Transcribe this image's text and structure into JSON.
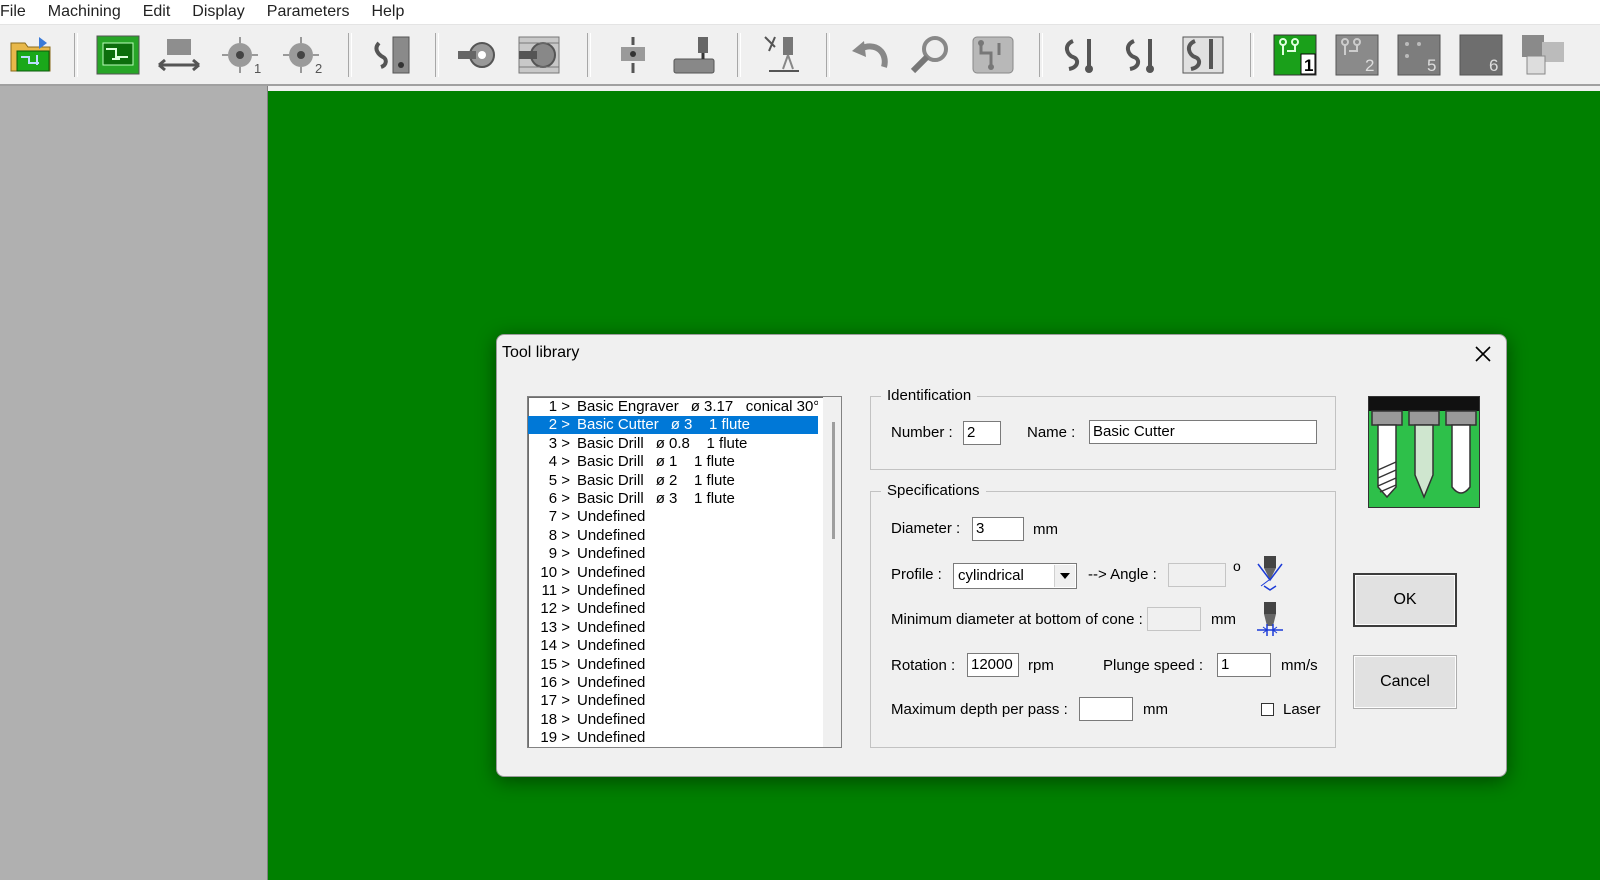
{
  "menu": [
    "File",
    "Machining",
    "Edit",
    "Display",
    "Parameters",
    "Help"
  ],
  "colors": {
    "canvas": "#008000",
    "selection": "#0078d7",
    "panel": "#b0b0b0"
  },
  "toolbar": {
    "icons": [
      "open-board-icon",
      "pcb-board-icon",
      "align-icon",
      "drill-side-1-icon",
      "drill-side-2-icon",
      "routing-icon",
      "pad-icon",
      "multipad-icon",
      "probe-icon",
      "cnc-spindle-icon",
      "laser-icon",
      "undo-icon",
      "zoom-icon",
      "circuit-icon",
      "track-1-icon",
      "track-2-icon",
      "track-3-icon"
    ],
    "layer_buttons": [
      "1",
      "2",
      "5",
      "6"
    ]
  },
  "dialog": {
    "title": "Tool library",
    "tools": [
      {
        "num": "1 >",
        "name": "Basic Engraver",
        "spec": "ø 3.17   conical 30°"
      },
      {
        "num": "2 >",
        "name": "Basic Cutter",
        "spec": "ø 3    1 flute"
      },
      {
        "num": "3 >",
        "name": "Basic Drill",
        "spec": "ø 0.8    1 flute"
      },
      {
        "num": "4 >",
        "name": "Basic Drill",
        "spec": "ø 1    1 flute"
      },
      {
        "num": "5 >",
        "name": "Basic Drill",
        "spec": "ø 2    1 flute"
      },
      {
        "num": "6 >",
        "name": "Basic Drill",
        "spec": "ø 3    1 flute"
      },
      {
        "num": "7 >",
        "name": "Undefined",
        "spec": ""
      },
      {
        "num": "8 >",
        "name": "Undefined",
        "spec": ""
      },
      {
        "num": "9 >",
        "name": "Undefined",
        "spec": ""
      },
      {
        "num": "10 >",
        "name": "Undefined",
        "spec": ""
      },
      {
        "num": "11 >",
        "name": "Undefined",
        "spec": ""
      },
      {
        "num": "12 >",
        "name": "Undefined",
        "spec": ""
      },
      {
        "num": "13 >",
        "name": "Undefined",
        "spec": ""
      },
      {
        "num": "14 >",
        "name": "Undefined",
        "spec": ""
      },
      {
        "num": "15 >",
        "name": "Undefined",
        "spec": ""
      },
      {
        "num": "16 >",
        "name": "Undefined",
        "spec": ""
      },
      {
        "num": "17 >",
        "name": "Undefined",
        "spec": ""
      },
      {
        "num": "18 >",
        "name": "Undefined",
        "spec": ""
      },
      {
        "num": "19 >",
        "name": "Undefined",
        "spec": ""
      }
    ],
    "selected_index": 1,
    "identification": {
      "title": "Identification",
      "number_label": "Number :",
      "number_value": "2",
      "name_label": "Name :",
      "name_value": "Basic Cutter"
    },
    "specifications": {
      "title": "Specifications",
      "diameter_label": "Diameter :",
      "diameter_value": "3",
      "diameter_unit": "mm",
      "profile_label": "Profile :",
      "profile_value": "cylindrical",
      "angle_label": "-->  Angle :",
      "angle_value": "",
      "angle_unit": "o",
      "min_diameter_label": "Minimum diameter at bottom of cone :",
      "min_diameter_value": "",
      "min_diameter_unit": "mm",
      "rotation_label": "Rotation :",
      "rotation_value": "12000",
      "rotation_unit": "rpm",
      "plunge_label": "Plunge speed :",
      "plunge_value": "1",
      "plunge_unit": "mm/s",
      "depth_label": "Maximum depth per pass :",
      "depth_value": "",
      "depth_unit": "mm",
      "laser_label": "Laser",
      "laser_checked": false
    },
    "ok_label": "OK",
    "cancel_label": "Cancel"
  }
}
